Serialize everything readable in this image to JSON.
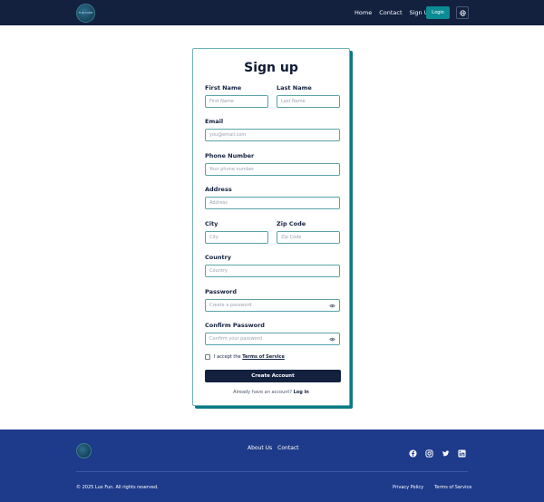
{
  "header": {
    "logo_text": "FUN CAMP",
    "nav": [
      "Home",
      "Contact",
      "Sign Up"
    ],
    "login_label": "Login"
  },
  "form": {
    "title": "Sign up",
    "first_name": {
      "label": "First Name",
      "placeholder": "First Name"
    },
    "last_name": {
      "label": "Last Name",
      "placeholder": "Last Name"
    },
    "email": {
      "label": "Email",
      "placeholder": "you@email.com"
    },
    "phone": {
      "label": "Phone Number",
      "placeholder": "Your phone number"
    },
    "address": {
      "label": "Address",
      "placeholder": "Address"
    },
    "city": {
      "label": "City",
      "placeholder": "City"
    },
    "zip": {
      "label": "Zip Code",
      "placeholder": "Zip Code"
    },
    "country": {
      "label": "Country",
      "placeholder": "Country"
    },
    "password": {
      "label": "Password",
      "placeholder": "Create a password"
    },
    "confirm_password": {
      "label": "Confirm Password",
      "placeholder": "Confirm your password"
    },
    "terms_prefix": "I accept the ",
    "terms_link": "Terms of Service",
    "submit_label": "Create Account",
    "already_text": "Already have an account? ",
    "login_link": "Log in"
  },
  "footer": {
    "links": [
      "About Us",
      "Contact"
    ],
    "copyright": "© 2025 Lux Fun. All rights reserved.",
    "privacy": "Privacy Policy",
    "terms": "Terms of Service"
  },
  "colors": {
    "header_bg": "#13213f",
    "accent": "#0b8b94",
    "footer_bg": "#1e3a8a"
  }
}
